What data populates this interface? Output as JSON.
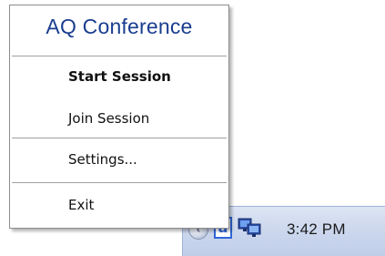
{
  "menu": {
    "title": "AQ Conference",
    "items": [
      {
        "label": "Start Session",
        "bold": true
      },
      {
        "label": "Join Session",
        "bold": false
      },
      {
        "label": "Settings...",
        "bold": false
      },
      {
        "label": "Exit",
        "bold": false
      }
    ]
  },
  "tray": {
    "expand_glyph": "‹",
    "app_icon_letter": "a",
    "clock": "3:42 PM",
    "icons": [
      "tray-expand-icon",
      "aq-conference-icon",
      "network-icon"
    ]
  },
  "colors": {
    "title": "#1a3d8f",
    "menu_background": "#ffffff",
    "tray_background": "#cdd8ee",
    "app_icon": "#2f67d8"
  }
}
